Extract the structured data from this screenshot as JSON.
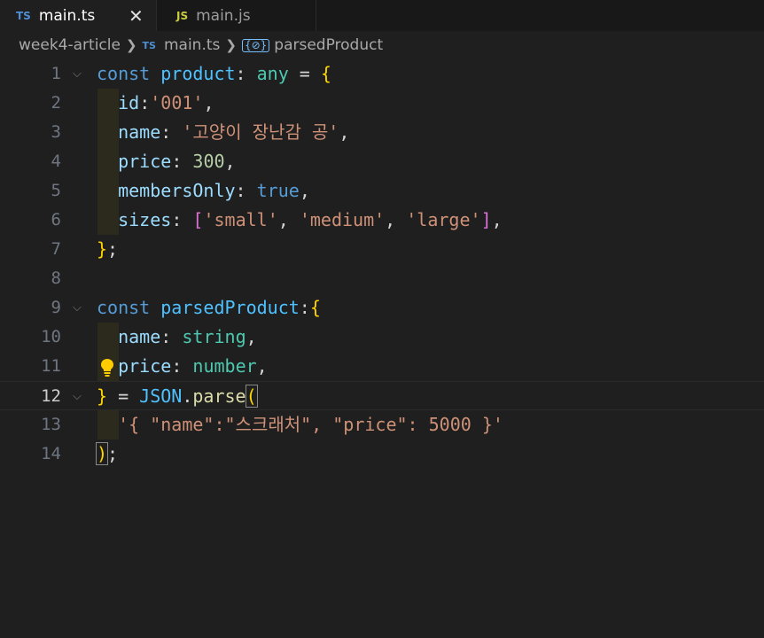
{
  "tabs": [
    {
      "icon": "TS",
      "label": "main.ts",
      "active": true,
      "close": "✕"
    },
    {
      "icon": "JS",
      "label": "main.js",
      "active": false
    }
  ],
  "breadcrumb": {
    "folder": "week4-article",
    "file_icon": "TS",
    "file": "main.ts",
    "symbol_icon": "{⊘}",
    "symbol": "parsedProduct"
  },
  "editor": {
    "current_line": 12,
    "lines": [
      {
        "n": "1",
        "fold": "⌵",
        "tokens": [
          [
            "kw",
            "const "
          ],
          [
            "var",
            "product"
          ],
          [
            "op",
            ": "
          ],
          [
            "type",
            "any"
          ],
          [
            "op",
            " = "
          ],
          [
            "br1",
            "{"
          ]
        ]
      },
      {
        "n": "2",
        "tokens": [
          [
            "op",
            "  "
          ],
          [
            "prop",
            "id"
          ],
          [
            "op",
            ":"
          ],
          [
            "str",
            "'001'"
          ],
          [
            "op",
            ","
          ]
        ]
      },
      {
        "n": "3",
        "tokens": [
          [
            "op",
            "  "
          ],
          [
            "prop",
            "name"
          ],
          [
            "op",
            ": "
          ],
          [
            "str",
            "'고양이 장난감 공'"
          ],
          [
            "op",
            ","
          ]
        ]
      },
      {
        "n": "4",
        "tokens": [
          [
            "op",
            "  "
          ],
          [
            "prop",
            "price"
          ],
          [
            "op",
            ": "
          ],
          [
            "num",
            "300"
          ],
          [
            "op",
            ","
          ]
        ]
      },
      {
        "n": "5",
        "tokens": [
          [
            "op",
            "  "
          ],
          [
            "prop",
            "membersOnly"
          ],
          [
            "op",
            ": "
          ],
          [
            "kw",
            "true"
          ],
          [
            "op",
            ","
          ]
        ]
      },
      {
        "n": "6",
        "tokens": [
          [
            "op",
            "  "
          ],
          [
            "prop",
            "sizes"
          ],
          [
            "op",
            ": "
          ],
          [
            "br2",
            "["
          ],
          [
            "str",
            "'small'"
          ],
          [
            "op",
            ", "
          ],
          [
            "str",
            "'medium'"
          ],
          [
            "op",
            ", "
          ],
          [
            "str",
            "'large'"
          ],
          [
            "br2",
            "]"
          ],
          [
            "op",
            ","
          ]
        ]
      },
      {
        "n": "7",
        "tokens": [
          [
            "br1",
            "}"
          ],
          [
            "op",
            ";"
          ]
        ]
      },
      {
        "n": "8",
        "tokens": []
      },
      {
        "n": "9",
        "fold": "⌵",
        "tokens": [
          [
            "kw",
            "const "
          ],
          [
            "var",
            "parsedProduct"
          ],
          [
            "op",
            ":"
          ],
          [
            "br1",
            "{"
          ]
        ]
      },
      {
        "n": "10",
        "tokens": [
          [
            "op",
            "  "
          ],
          [
            "prop",
            "name"
          ],
          [
            "op",
            ": "
          ],
          [
            "type",
            "string"
          ],
          [
            "op",
            ","
          ]
        ]
      },
      {
        "n": "11",
        "tokens": [
          [
            "op",
            "  "
          ],
          [
            "prop",
            "price"
          ],
          [
            "op",
            ": "
          ],
          [
            "type",
            "number"
          ],
          [
            "op",
            ","
          ]
        ]
      },
      {
        "n": "12",
        "fold": "⌵",
        "tokens": [
          [
            "br1",
            "}"
          ],
          [
            "op",
            " = "
          ],
          [
            "var",
            "JSON"
          ],
          [
            "op",
            "."
          ],
          [
            "fn",
            "parse"
          ],
          [
            "br1",
            "("
          ]
        ]
      },
      {
        "n": "13",
        "tokens": [
          [
            "op",
            "  "
          ],
          [
            "str",
            "'{ \"name\":\"스크래처\", \"price\": 5000 }'"
          ]
        ]
      },
      {
        "n": "14",
        "tokens": [
          [
            "br1",
            ")"
          ],
          [
            "op",
            ";"
          ]
        ]
      }
    ]
  },
  "colors": {
    "keyword": "#569cd6",
    "variable": "#4fc1ff",
    "property": "#9cdcfe",
    "type": "#4ec9b0",
    "string": "#ce9178",
    "number": "#b5cea8",
    "bracket_gold": "#ffd700",
    "bracket_purple": "#da70d6"
  },
  "icons": {
    "lightbulb": "lightbulb-icon",
    "close": "close-icon",
    "fold": "chevron-down-icon"
  }
}
